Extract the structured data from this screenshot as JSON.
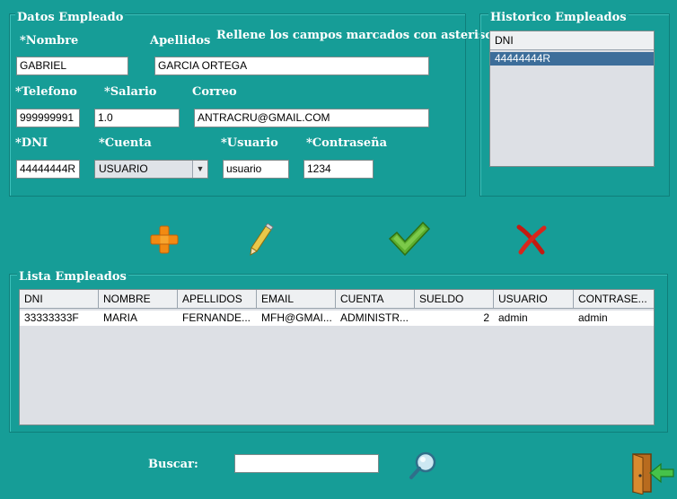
{
  "datos": {
    "legend": "Datos Empleado",
    "hint": "Rellene los campos marcados con asteriscos",
    "nombre_label": "*Nombre",
    "nombre_value": "GABRIEL",
    "apellidos_label": "Apellidos",
    "apellidos_value": "GARCIA ORTEGA",
    "telefono_label": "*Telefono",
    "telefono_value": "999999991",
    "salario_label": "*Salario",
    "salario_value": "1.0",
    "correo_label": "Correo",
    "correo_value": "ANTRACRU@GMAIL.COM",
    "dni_label": "*DNI",
    "dni_value": "44444444R",
    "cuenta_label": "*Cuenta",
    "cuenta_value": "USUARIO",
    "usuario_label": "*Usuario",
    "usuario_value": "usuario",
    "contrasena_label": "*Contraseña",
    "contrasena_value": "1234"
  },
  "historico": {
    "legend": "Historico Empleados",
    "header": "DNI",
    "items": [
      "44444444R"
    ]
  },
  "toolbar": {
    "add_icon": "plus-icon",
    "edit_icon": "pencil-icon",
    "confirm_icon": "checkmark-icon",
    "delete_icon": "red-x-icon"
  },
  "lista": {
    "legend": "Lista Empleados",
    "columns": [
      "DNI",
      "NOMBRE",
      "APELLIDOS",
      "EMAIL",
      "CUENTA",
      "SUELDO",
      "USUARIO",
      "CONTRASE..."
    ],
    "rows": [
      [
        "33333333F",
        "MARIA",
        "FERNANDE...",
        "MFH@GMAI...",
        "ADMINISTR...",
        "2",
        "admin",
        "admin"
      ]
    ]
  },
  "buscar": {
    "label": "Buscar:",
    "value": "",
    "search_icon": "magnifier-icon",
    "exit_icon": "exit-door-icon"
  },
  "colors": {
    "background": "#169d97",
    "selection": "#3d6e9a"
  }
}
